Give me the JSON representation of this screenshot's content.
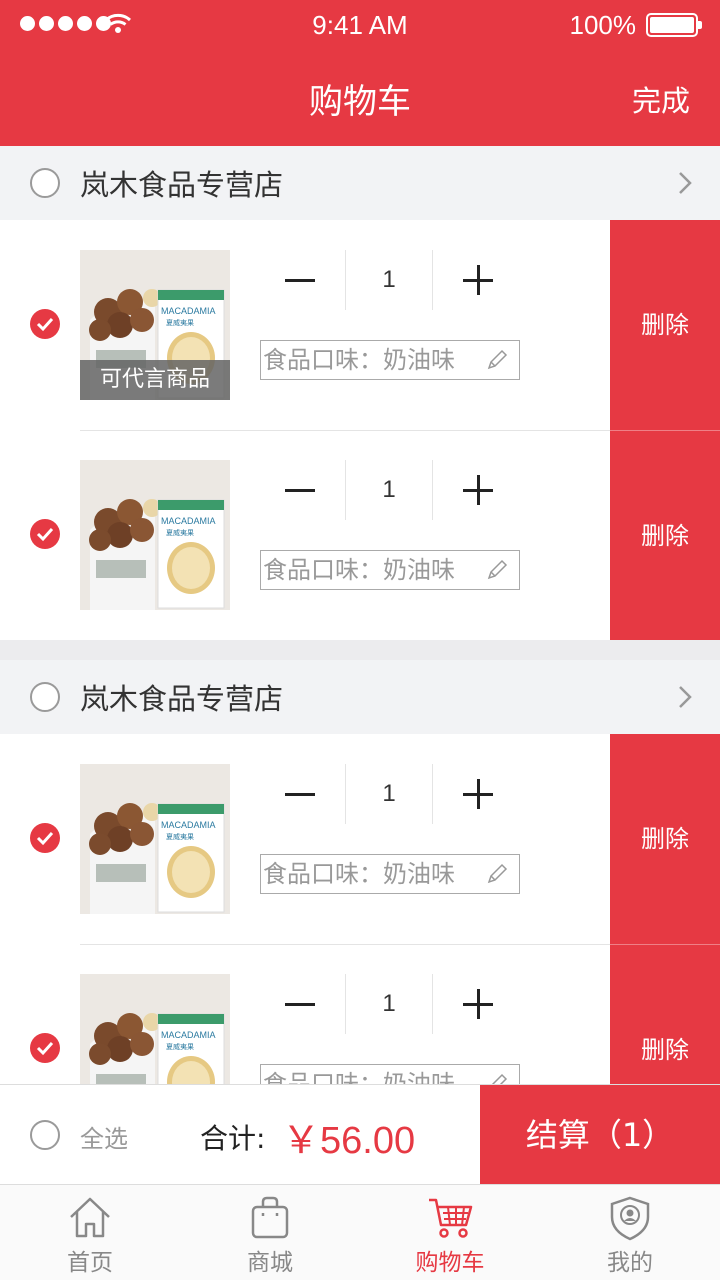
{
  "status_bar": {
    "time": "9:41 AM",
    "battery": "100%"
  },
  "header": {
    "title": "购物车",
    "done_label": "完成"
  },
  "stores": [
    {
      "name": "岚木食品专营店",
      "items": [
        {
          "quantity": "1",
          "flavor": "食品口味：奶油味",
          "tag": "可代言商品",
          "delete_label": "删除",
          "checked": true
        },
        {
          "quantity": "1",
          "flavor": "食品口味：奶油味",
          "delete_label": "删除",
          "checked": true
        }
      ]
    },
    {
      "name": "岚木食品专营店",
      "items": [
        {
          "quantity": "1",
          "flavor": "食品口味：奶油味",
          "delete_label": "删除",
          "checked": true
        },
        {
          "quantity": "1",
          "flavor": "食品口味：奶油味",
          "delete_label": "删除",
          "checked": true
        }
      ]
    }
  ],
  "product_image_text": {
    "brand": "MACADAMIA",
    "sub": "夏威夷果"
  },
  "checkout": {
    "select_all_label": "全选",
    "total_label": "合计:",
    "total_amount": "￥56.00",
    "checkout_label": "结算（1）"
  },
  "tabs": [
    {
      "label": "首页",
      "icon": "home-icon",
      "active": false
    },
    {
      "label": "商城",
      "icon": "bag-icon",
      "active": false
    },
    {
      "label": "购物车",
      "icon": "cart-icon",
      "active": true
    },
    {
      "label": "我的",
      "icon": "profile-shield-icon",
      "active": false
    }
  ],
  "colors": {
    "accent": "#e63943",
    "background": "#ececee"
  }
}
